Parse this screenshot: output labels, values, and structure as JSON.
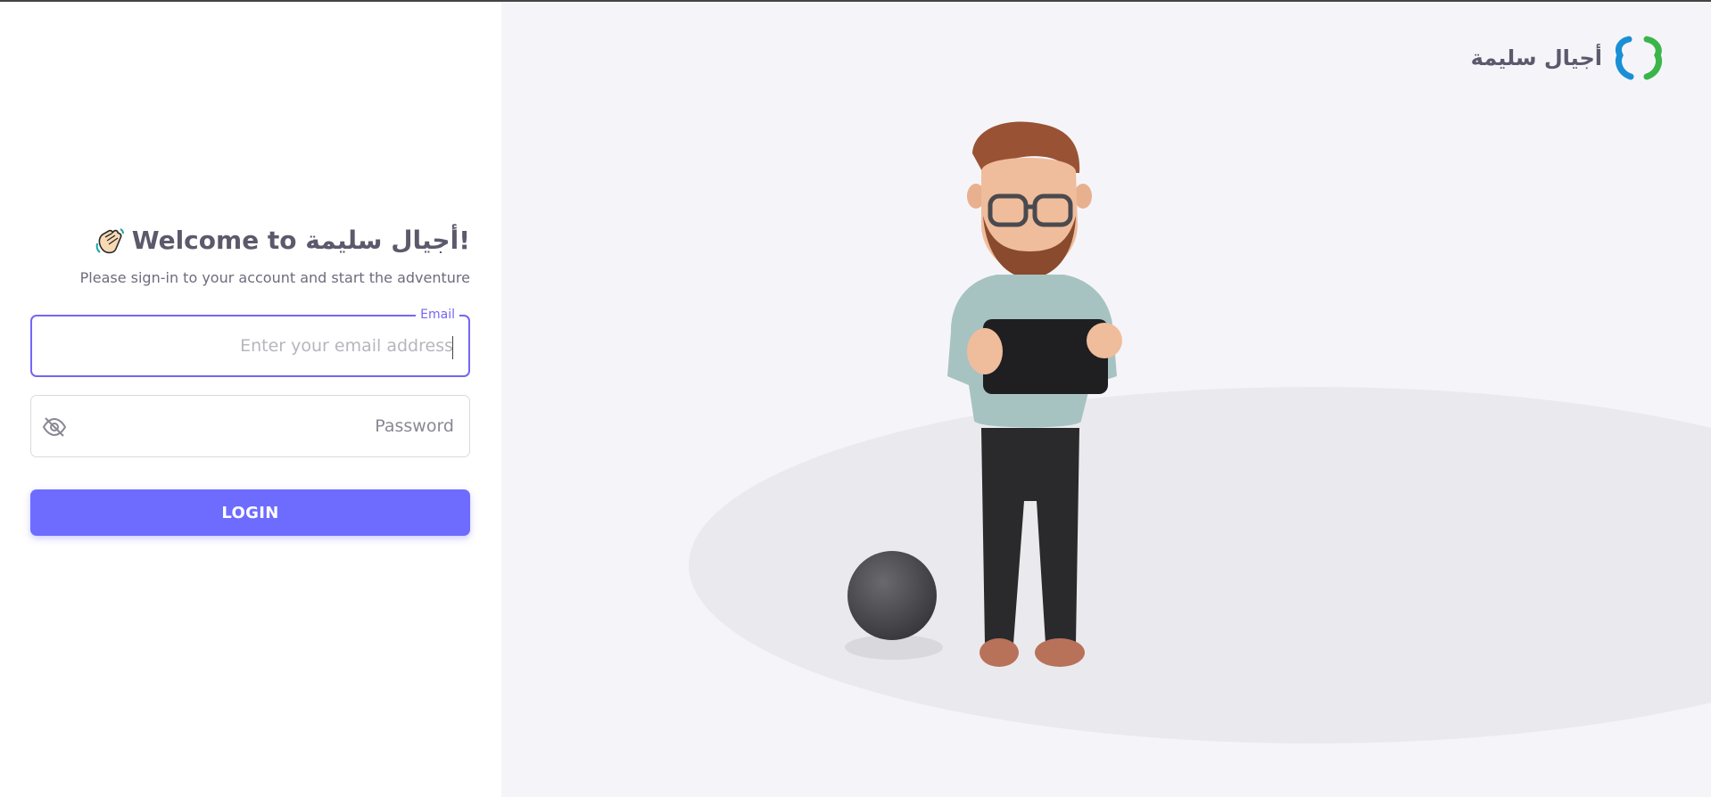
{
  "brand": {
    "name": "أجيال سليمة",
    "colors": {
      "accent": "#7367f0",
      "button": "#6d6cff",
      "logo_blue": "#1b8fd6",
      "logo_green": "#3ab54a"
    }
  },
  "login": {
    "title": "Welcome to أجيال سليمة!",
    "title_icon": "waving-hand-icon",
    "subtitle": "Please sign-in to your account and start the adventure",
    "email": {
      "label": "Email",
      "placeholder": "Enter your email address",
      "value": ""
    },
    "password": {
      "placeholder": "Password",
      "value": "",
      "toggle_icon": "eye-off-icon"
    },
    "submit_label": "LOGIN"
  },
  "illustration": {
    "subject": "3d-man-with-tablet",
    "prop": "ball"
  }
}
